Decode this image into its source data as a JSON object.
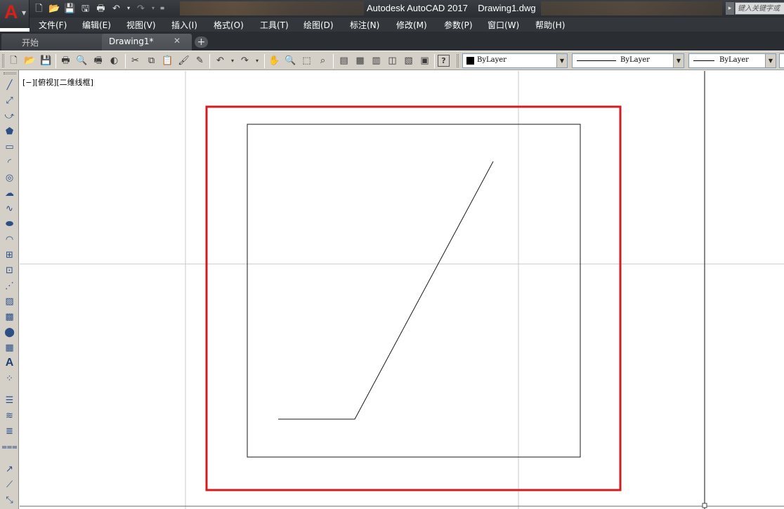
{
  "window": {
    "title": "Autodesk AutoCAD 2017    Drawing1.dwg",
    "app_logo": "A",
    "search_placeholder": "键入关键字或"
  },
  "quick_access": [
    "new-icon",
    "open-icon",
    "save-icon",
    "save-as-icon",
    "plot-icon",
    "undo-icon",
    "redo-icon",
    "customize-icon"
  ],
  "menu": [
    "文件(F)",
    "编辑(E)",
    "视图(V)",
    "插入(I)",
    "格式(O)",
    "工具(T)",
    "绘图(D)",
    "标注(N)",
    "修改(M)",
    "参数(P)",
    "窗口(W)",
    "帮助(H)"
  ],
  "tabs": {
    "start": "开始",
    "drawing": "Drawing1*",
    "close": "✕",
    "add": "+"
  },
  "properties": {
    "color": "ByLayer",
    "linetype": "ByLayer",
    "lineweight": "ByLayer"
  },
  "viewport": {
    "label": "[−][俯视][二维线框]"
  },
  "colors": {
    "highlight": "#d71920",
    "app_red": "#d6201a"
  },
  "vertical_tools": [
    "line-icon",
    "construction-line-icon",
    "polyline-icon",
    "polygon-icon",
    "rectangle-icon",
    "arc-icon",
    "circle-icon",
    "revision-cloud-icon",
    "spline-icon",
    "ellipse-icon",
    "ellipse-arc-icon",
    "insert-block-icon",
    "make-block-icon",
    "point-icon",
    "hatch-icon",
    "gradient-icon",
    "region-icon",
    "table-icon",
    "multiline-text-icon",
    "add-selected-icon",
    "layer-icon",
    "layer-states-icon",
    "layer-walk-icon",
    "layer-isolate-icon",
    "dimension-icon",
    "leader-icon",
    "measure-icon"
  ]
}
